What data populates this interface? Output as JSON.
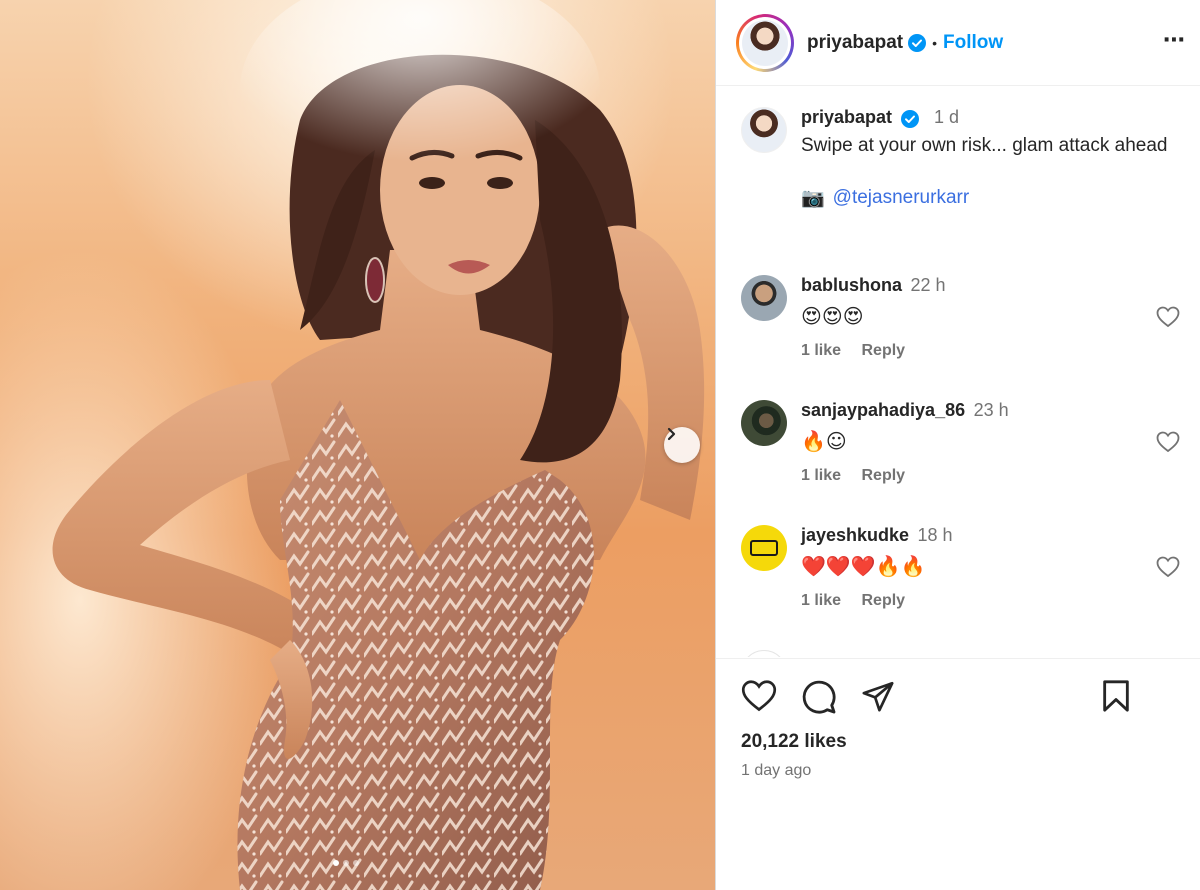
{
  "post": {
    "image_alt": "Woman in a sequined rose-gold gown posing against a warm orange backdrop",
    "carousel_dots": 3,
    "active_dot": 1
  },
  "header": {
    "username": "priyabapat",
    "separator": "•",
    "follow_label": "Follow",
    "more_label": "⋯"
  },
  "caption": {
    "username": "priyabapat",
    "time": "1 d",
    "text": "Swipe at your own risk... glam attack ahead",
    "camera_icon": "📷",
    "mention": "@tejasnerurkarr"
  },
  "comments": [
    {
      "username": "bablushona",
      "time": "22 h",
      "text": "😍😍😍",
      "likes": "1 like",
      "reply": "Reply"
    },
    {
      "username": "sanjaypahadiya_86",
      "time": "23 h",
      "text": "🔥☺",
      "likes": "1 like",
      "reply": "Reply"
    },
    {
      "username": "jayeshkudke",
      "time": "18 h",
      "text": "❤️❤️❤️🔥🔥",
      "likes": "1 like",
      "reply": "Reply"
    }
  ],
  "footer": {
    "likes": "20,122 likes",
    "posted": "1 day ago"
  },
  "colors": {
    "follow": "#0095f6",
    "mention": "#3b6fe0",
    "verified": "#0095f6",
    "muted": "#737373"
  }
}
